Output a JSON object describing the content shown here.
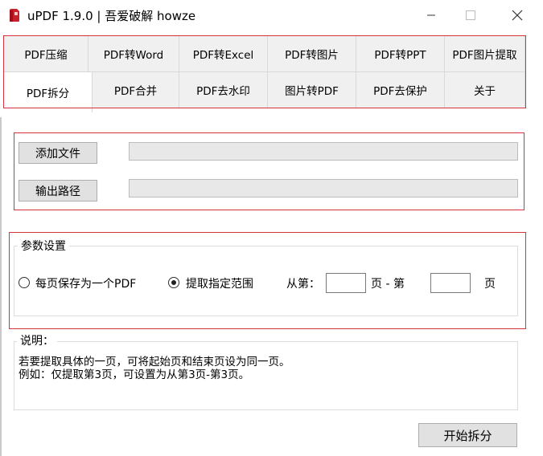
{
  "window": {
    "title": "uPDF 1.9.0 | 吾爱破解 howze",
    "controls": [
      "minimize-icon",
      "maximize-icon",
      "close-icon"
    ]
  },
  "tabs": {
    "row1": [
      "PDF压缩",
      "PDF转Word",
      "PDF转Excel",
      "PDF转图片",
      "PDF转PPT",
      "PDF图片提取"
    ],
    "row2": [
      "PDF拆分",
      "PDF合并",
      "PDF去水印",
      "图片转PDF",
      "PDF去保护",
      "关于"
    ],
    "active": "PDF拆分"
  },
  "files": {
    "add_button": "添加文件",
    "add_value": "",
    "output_button": "输出路径",
    "output_value": ""
  },
  "params": {
    "legend": "参数设置",
    "option1": "每页保存为一个PDF",
    "option2": "提取指定范围",
    "selected": "option2",
    "from_label": "从第：",
    "from_value": "",
    "mid_label": "页 - 第",
    "to_value": "",
    "end_label": "页"
  },
  "notes": {
    "legend": "说明：",
    "line1": "若要提取具体的一页，可将起始页和结束页设为同一页。",
    "line2": "例如：仅提取第3页，可设置为从第3页-第3页。"
  },
  "actions": {
    "start_button": "开始拆分"
  },
  "colors": {
    "highlight_frame": "#d8333d",
    "app_icon": "#c8202a"
  }
}
